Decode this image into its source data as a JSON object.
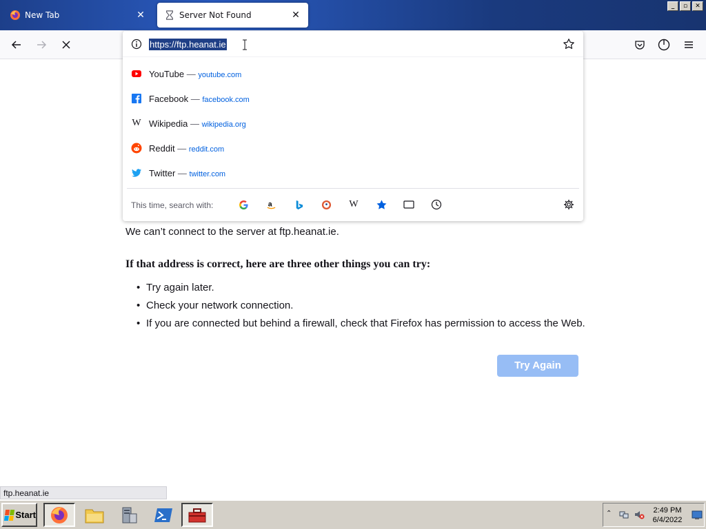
{
  "window": {
    "controls": [
      "_",
      "▫",
      "✕"
    ]
  },
  "tabs": [
    {
      "label": "New Tab",
      "icon": "firefox-icon",
      "active": false
    },
    {
      "label": "Server Not Found",
      "icon": "hourglass-icon",
      "active": true
    }
  ],
  "urlbar": {
    "value": "https://ftp.heanat.ie",
    "suggestions": [
      {
        "title": "YouTube",
        "sep": " — ",
        "url": "youtube.com",
        "icon": "youtube-icon",
        "color": "#ff0000"
      },
      {
        "title": "Facebook",
        "sep": " — ",
        "url": "facebook.com",
        "icon": "facebook-icon",
        "color": "#1877f2"
      },
      {
        "title": "Wikipedia",
        "sep": " — ",
        "url": "wikipedia.org",
        "icon": "wikipedia-icon",
        "color": "#000000"
      },
      {
        "title": "Reddit",
        "sep": " — ",
        "url": "reddit.com",
        "icon": "reddit-icon",
        "color": "#ff4500"
      },
      {
        "title": "Twitter",
        "sep": " — ",
        "url": "twitter.com",
        "icon": "twitter-icon",
        "color": "#1da1f2"
      }
    ],
    "search_with_label": "This time, search with:",
    "engines": [
      "google-icon",
      "amazon-icon",
      "bing-icon",
      "duckduckgo-icon",
      "wikipedia-search-icon",
      "bookmarks-icon",
      "tabs-icon",
      "history-icon"
    ]
  },
  "page": {
    "description": "We can’t connect to the server at ftp.heanat.ie.",
    "heading": "If that address is correct, here are three other things you can try:",
    "tips": [
      "Try again later.",
      "Check your network connection.",
      "If you are connected but behind a firewall, check that Firefox has permission to access the Web."
    ],
    "try_again_label": "Try Again",
    "accent": "#97bdf5"
  },
  "statusbar": {
    "text": "ftp.heanat.ie"
  },
  "taskbar": {
    "start_label": "Start",
    "time": "2:49 PM",
    "date": "6/4/2022"
  }
}
